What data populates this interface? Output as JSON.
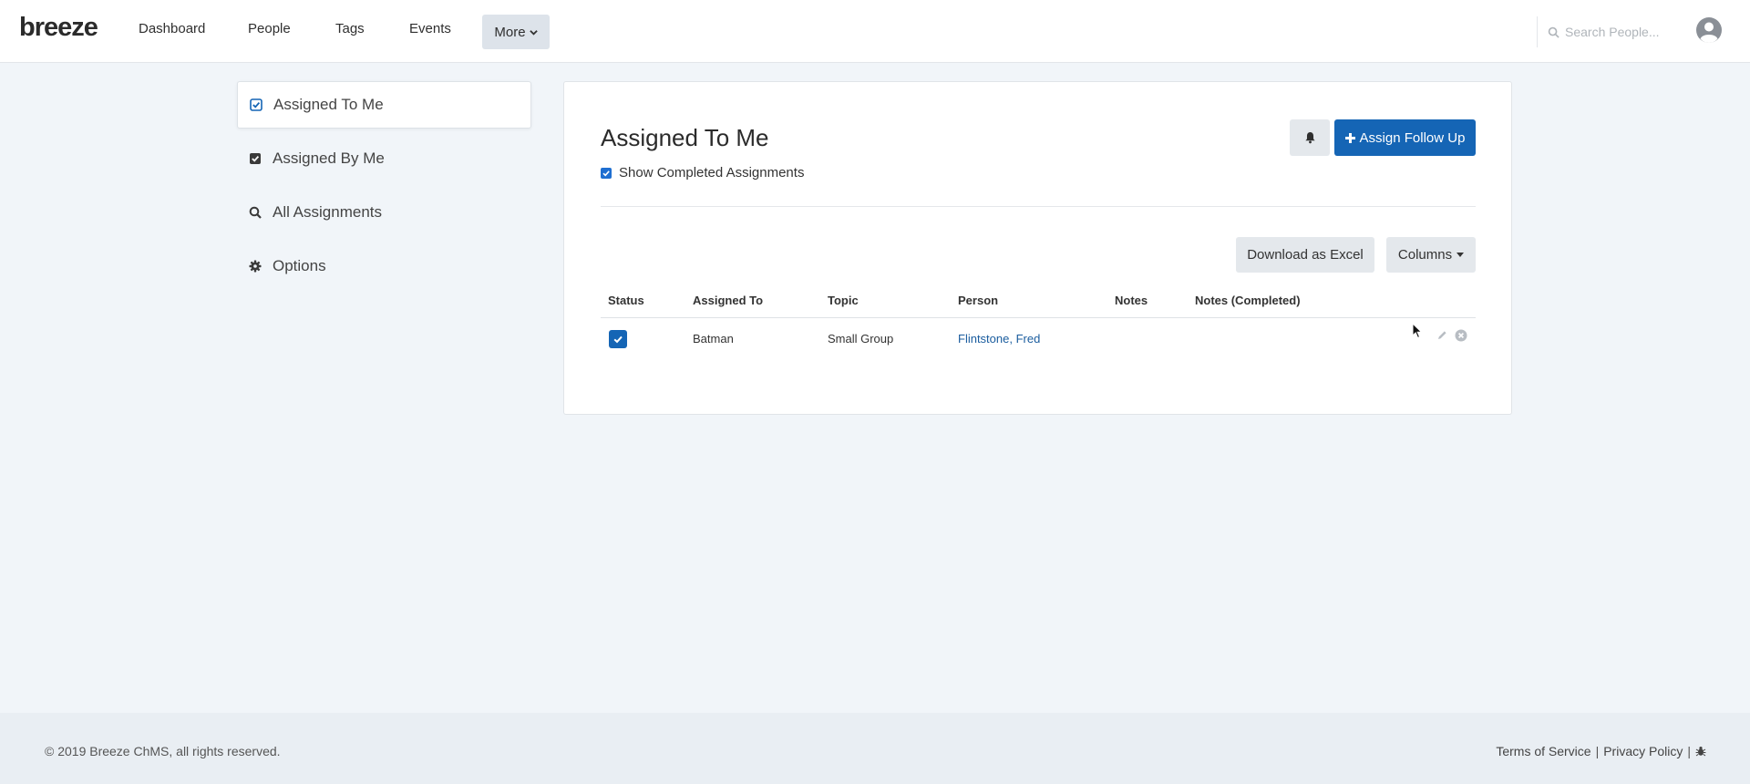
{
  "nav": {
    "logo": "breeze",
    "links": [
      "Dashboard",
      "People",
      "Tags",
      "Events"
    ],
    "more_label": "More",
    "search_placeholder": "Search People..."
  },
  "sidebar": {
    "items": [
      {
        "label": "Assigned To Me",
        "icon": "check-square-icon",
        "active": true
      },
      {
        "label": "Assigned By Me",
        "icon": "check-square-icon",
        "active": false
      },
      {
        "label": "All Assignments",
        "icon": "search-icon",
        "active": false
      },
      {
        "label": "Options",
        "icon": "gear-icon",
        "active": false
      }
    ]
  },
  "main": {
    "title": "Assigned To Me",
    "show_completed_label": "Show Completed Assignments",
    "show_completed_checked": true,
    "assign_button": "Assign Follow Up",
    "download_button": "Download as Excel",
    "columns_button": "Columns",
    "table": {
      "headers": [
        "Status",
        "Assigned To",
        "Topic",
        "Person",
        "Notes",
        "Notes (Completed)"
      ],
      "rows": [
        {
          "status_checked": true,
          "assigned_to": "Batman",
          "topic": "Small Group",
          "person": "Flintstone, Fred",
          "notes": "",
          "notes_completed": ""
        }
      ]
    }
  },
  "footer": {
    "copyright": "© 2019 Breeze ChMS, all rights reserved.",
    "terms": "Terms of Service",
    "privacy": "Privacy Policy",
    "separator": "|"
  },
  "colors": {
    "accent": "#1565b5",
    "link": "#1a5c9e",
    "background": "#f1f5f9"
  }
}
